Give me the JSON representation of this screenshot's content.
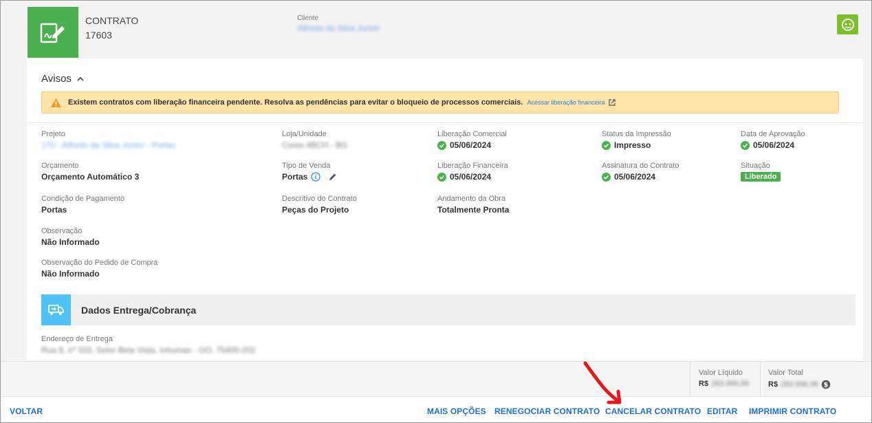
{
  "header": {
    "contract_label": "CONTRATO",
    "contract_number": "17603",
    "client_label": "Cliente",
    "client_name": "Alfredo da Silva Junior"
  },
  "avisos": {
    "title": "Avisos",
    "alert_message": "Existem contratos com liberação financeira pendente. Resolva as pendências para evitar o bloqueio de processos comerciais.",
    "alert_link": "Acessar liberação financeira"
  },
  "fields": {
    "projeto": {
      "label": "Projeto",
      "value": "170 - Alfredo da Silva Junior - Portas"
    },
    "loja": {
      "label": "Loja/Unidade",
      "value": "Cores 4BCH - BG"
    },
    "lib_comercial": {
      "label": "Liberação Comercial",
      "value": "05/06/2024"
    },
    "status_impressao": {
      "label": "Status da Impressão",
      "value": "Impresso"
    },
    "data_aprovacao": {
      "label": "Data de Aprovação",
      "value": "05/06/2024"
    },
    "orcamento": {
      "label": "Orçamento",
      "value": "Orçamento Automático 3"
    },
    "tipo_venda": {
      "label": "Tipo de Venda",
      "value": "Portas"
    },
    "lib_financeira": {
      "label": "Liberação Financeira",
      "value": "05/06/2024"
    },
    "assinatura": {
      "label": "Assinatura do Contrato",
      "value": "05/06/2024"
    },
    "situacao": {
      "label": "Situação",
      "value": "Liberado"
    },
    "condicao": {
      "label": "Condição de Pagamento",
      "value": "Portas"
    },
    "descritivo": {
      "label": "Descritivo do Contrato",
      "value": "Peças do Projeto"
    },
    "andamento": {
      "label": "Andamento da Obra",
      "value": "Totalmente Pronta"
    },
    "observacao": {
      "label": "Observação",
      "value": "Não Informado"
    },
    "obs_pedido": {
      "label": "Observação do Pedido de Compra",
      "value": "Não Informado"
    }
  },
  "entrega": {
    "section_title": "Dados Entrega/Cobrança",
    "endereco_label": "Endereço de Entrega",
    "endereco_value": "Rua 8, nº 333, Setor Bela Vista, Inhumas - GO, 75400-202"
  },
  "totals": {
    "liquido_label": "Valor Líquido",
    "liquido_currency": "R$",
    "liquido_value": "283.996,96",
    "total_label": "Valor Total",
    "total_currency": "R$",
    "total_value": "283.996,96"
  },
  "actions": {
    "back": "VOLTAR",
    "more": "MAIS OPÇÕES",
    "renegotiate": "RENEGOCIAR CONTRATO",
    "cancel": "CANCELAR CONTRATO",
    "edit": "EDITAR",
    "print": "IMPRIMIR CONTRATO"
  },
  "colors": {
    "brand_green": "#4caf50",
    "action_blue": "#1f6fd0",
    "alert_bg": "#fde3a7",
    "annotation_red": "#e3191b"
  }
}
